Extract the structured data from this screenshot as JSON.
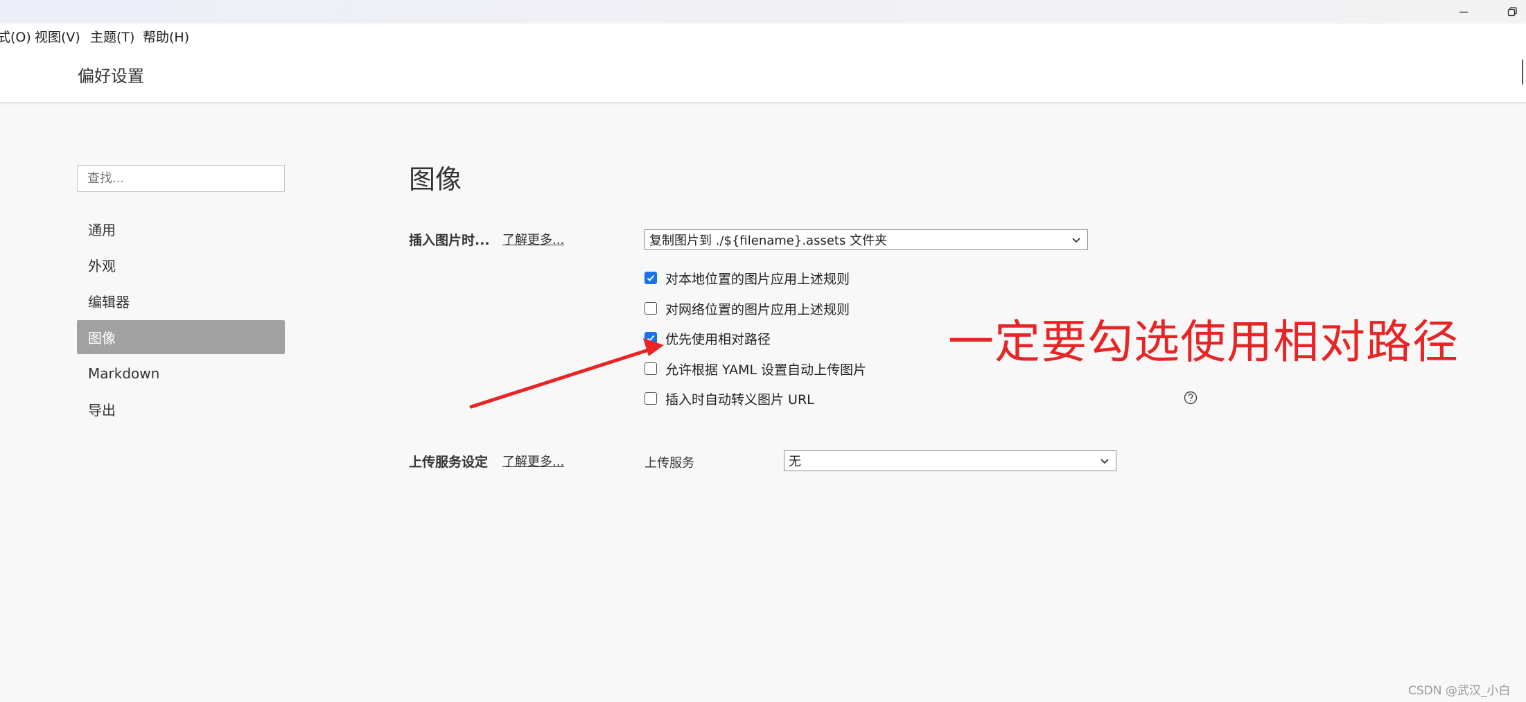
{
  "menu": {
    "items": [
      "式(O)",
      "视图(V)",
      "主题(T)",
      "帮助(H)"
    ]
  },
  "window": {
    "minimize_icon": "minimize-icon",
    "restore_icon": "restore-icon"
  },
  "header": {
    "title": "偏好设置"
  },
  "sidebar": {
    "search_placeholder": "查找...",
    "items": [
      {
        "label": "通用",
        "active": false
      },
      {
        "label": "外观",
        "active": false
      },
      {
        "label": "编辑器",
        "active": false
      },
      {
        "label": "图像",
        "active": true
      },
      {
        "label": "Markdown",
        "active": false
      },
      {
        "label": "导出",
        "active": false
      }
    ]
  },
  "main": {
    "section_title": "图像",
    "insert": {
      "label": "插入图片时...",
      "learn_more": "了解更多...",
      "select_value": "复制图片到 ./${filename}.assets 文件夹",
      "options": [
        {
          "label": "对本地位置的图片应用上述规则",
          "checked": true
        },
        {
          "label": "对网络位置的图片应用上述规则",
          "checked": false
        },
        {
          "label": "优先使用相对路径",
          "checked": true
        },
        {
          "label": "允许根据 YAML 设置自动上传图片",
          "checked": false
        },
        {
          "label": "插入时自动转义图片 URL",
          "checked": false
        }
      ]
    },
    "upload": {
      "label": "上传服务设定",
      "learn_more": "了解更多...",
      "service_label": "上传服务",
      "service_value": "无"
    }
  },
  "annotation": {
    "text": "一定要勾选使用相对路径",
    "color": "#e82424"
  },
  "watermark": "CSDN @武汉_小白",
  "colors": {
    "checkbox_checked": "#1a73e8",
    "active_nav_bg": "#a1a1a1"
  }
}
